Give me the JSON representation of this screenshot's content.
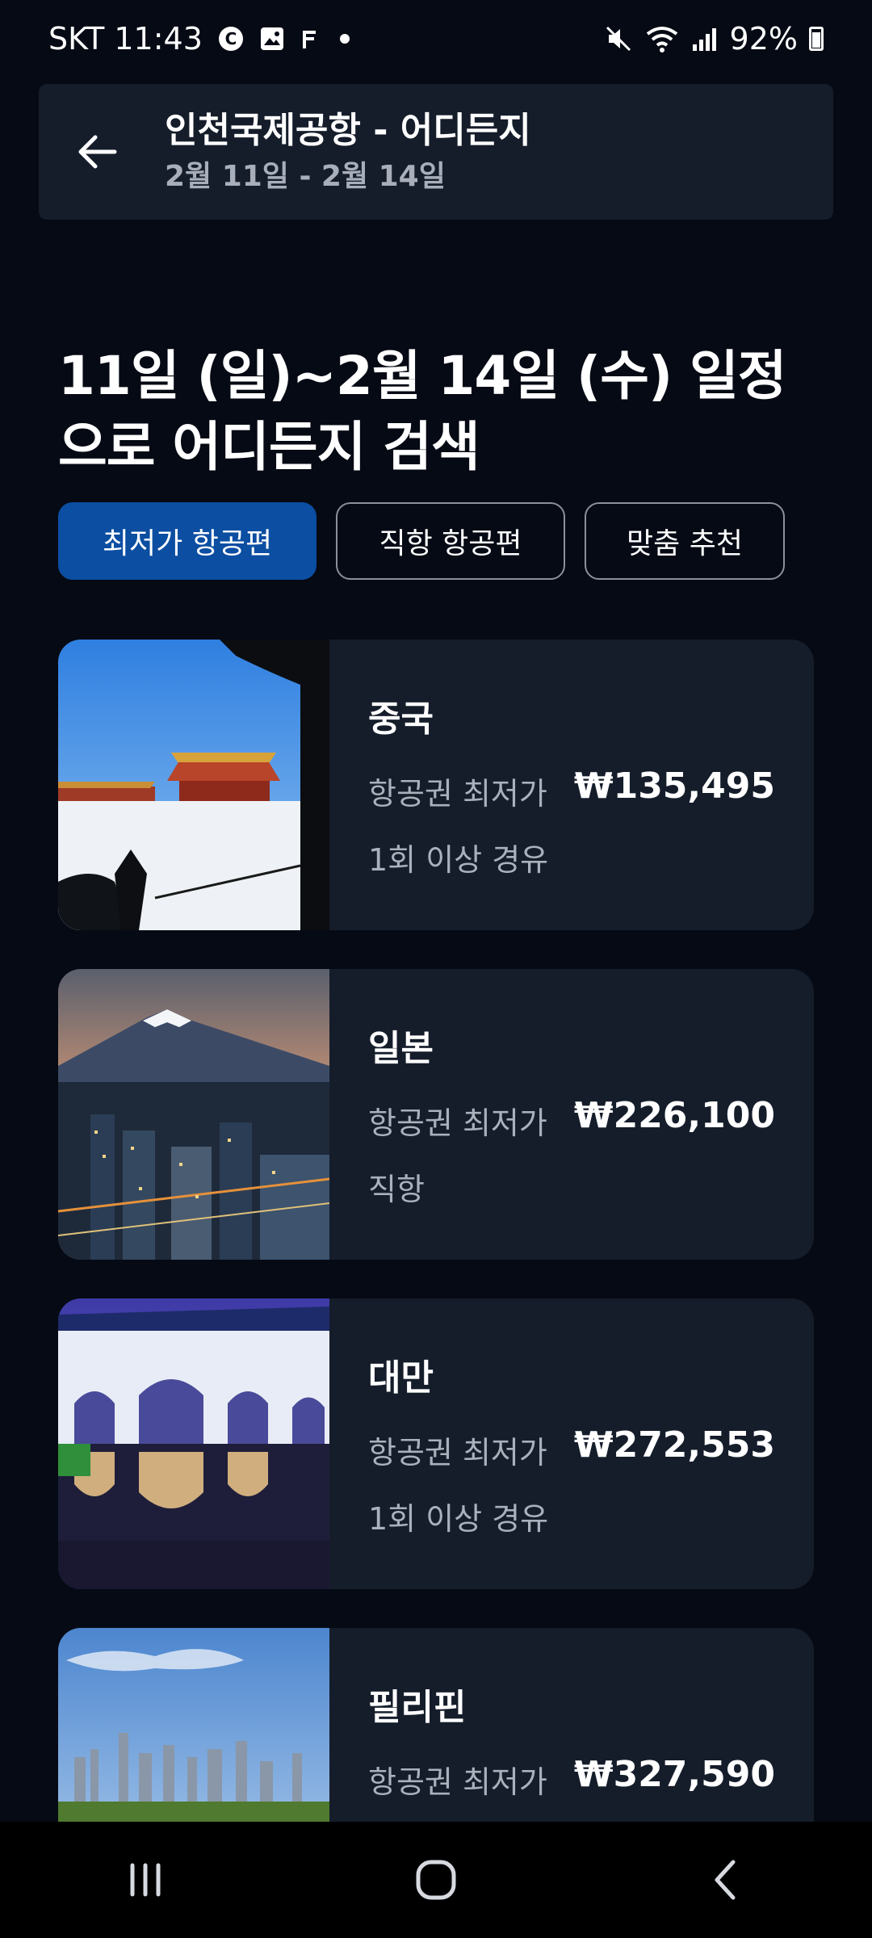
{
  "status_bar": {
    "carrier_time": "SKT 11:43",
    "battery": "92%",
    "icons": [
      "c-badge-icon",
      "gallery-icon",
      "f-icon",
      "dot-icon",
      "mute-icon",
      "wifi-icon",
      "signal-icon",
      "battery-icon"
    ]
  },
  "header": {
    "title": "인천국제공항 - 어디든지",
    "subtitle": "2월 11일 - 2월 14일",
    "back_icon": "arrow-left-icon"
  },
  "heading": {
    "text": "11일 (일)~2월 14일 (수) 일정으로 어디든지 검색"
  },
  "chips": [
    {
      "label": "최저가 항공편",
      "active": true
    },
    {
      "label": "직항 항공편",
      "active": false
    },
    {
      "label": "맞춤 추천",
      "active": false
    }
  ],
  "destinations": [
    {
      "country": "중국",
      "label": "항공권 최저가",
      "price": "₩135,495",
      "route": "1회 이상 경유",
      "image": "forbidden-city-snow-photo"
    },
    {
      "country": "일본",
      "label": "항공권 최저가",
      "price": "₩226,100",
      "route": "직항",
      "image": "mount-fuji-city-photo"
    },
    {
      "country": "대만",
      "label": "항공권 최저가",
      "price": "₩272,553",
      "route": "1회 이상 경유",
      "image": "liberty-square-gate-photo"
    },
    {
      "country": "필리핀",
      "label": "항공권 최저가",
      "price": "₩327,590",
      "route": "",
      "image": "manila-skyline-photo"
    }
  ],
  "nav": {
    "icons": [
      "recent-apps-icon",
      "home-icon",
      "back-icon"
    ]
  },
  "colors": {
    "background": "#050a14",
    "card": "#151d2b",
    "accent": "#0b4ea2",
    "secondary_text": "#aab1bc"
  }
}
